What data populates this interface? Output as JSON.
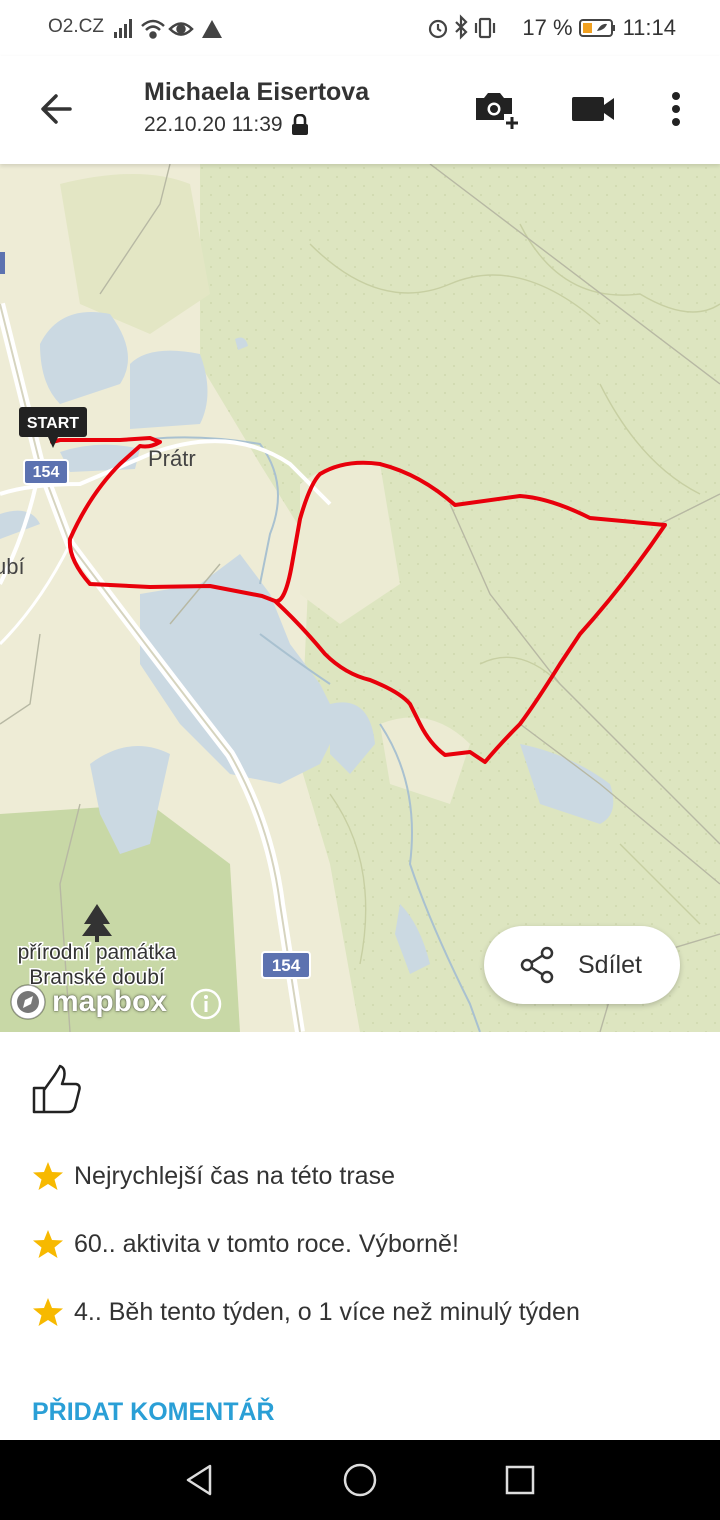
{
  "status_bar": {
    "carrier": "O2.CZ",
    "battery": "17 %",
    "time": "11:14"
  },
  "header": {
    "title": "Michaela Eisertova",
    "subtitle": "22.10.20 11:39"
  },
  "map": {
    "start_label": "START",
    "place_pratr": "Prátr",
    "place_doubi_partial": "ubí",
    "road_number_1": "154",
    "road_number_2": "154",
    "poi_line1": "přírodní památka",
    "poi_line2": "Branské doubí",
    "attribution": "mapbox",
    "share_label": "Sdílet",
    "route_color": "#e8000b"
  },
  "achievements": [
    "Nejrychlejší čas na této trase",
    "60.. aktivita v tomto roce. Výborně!",
    "4.. Běh tento týden, o 1 více než minulý týden"
  ],
  "add_comment_label": "PŘIDAT KOMENTÁŘ",
  "icons": [
    "signal-icon",
    "wifi-icon",
    "eye-icon",
    "alarm-icon",
    "bluetooth-icon",
    "vibrate-icon",
    "battery-icon",
    "back-arrow-icon",
    "add-photo-icon",
    "video-icon",
    "more-icon",
    "share-icon",
    "thumbs-up-icon",
    "star-icon",
    "info-icon",
    "tree-icon",
    "nav-back-icon",
    "nav-home-icon",
    "nav-recents-icon"
  ]
}
